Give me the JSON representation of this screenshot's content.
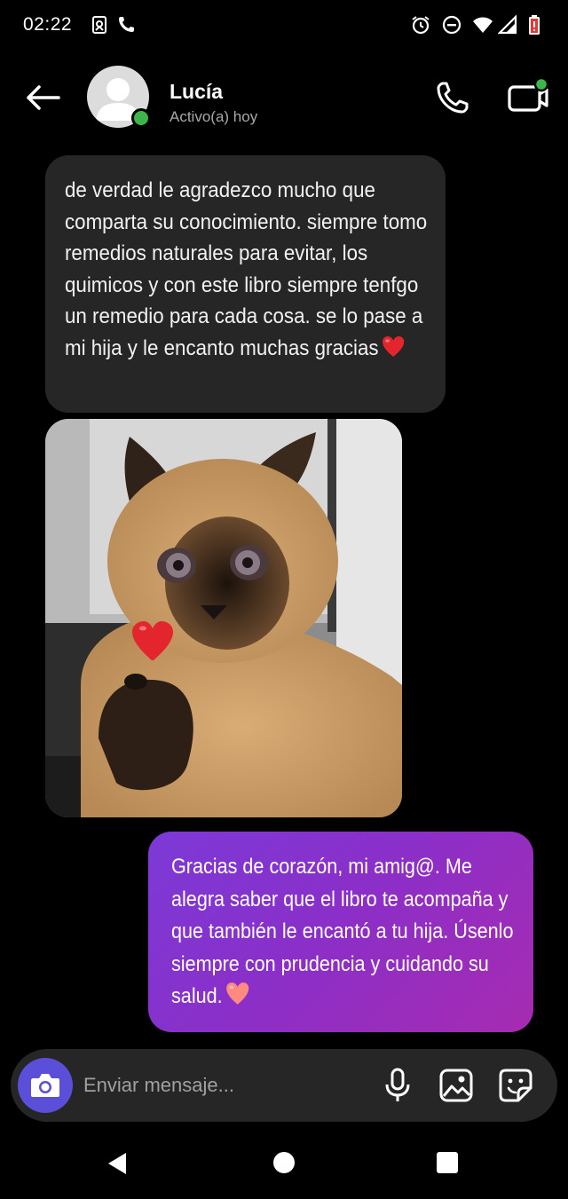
{
  "status_bar": {
    "time": "02:22",
    "left_icons": [
      "shield-screen-icon",
      "phone-call-icon"
    ],
    "right_icons": [
      "alarm-icon",
      "do-not-disturb-icon",
      "wifi-icon",
      "signal-icon",
      "battery-low-icon"
    ],
    "battery_color": "#e53935"
  },
  "header": {
    "contact_name": "Lucía",
    "contact_status": "Activo(a) hoy",
    "online_color": "#3cb54a",
    "icons": [
      "back-arrow-icon",
      "phone-icon",
      "video-camera-icon"
    ]
  },
  "messages": [
    {
      "direction": "incoming",
      "type": "text",
      "text": "de verdad le agradezco mucho que comparta su conocimiento. siempre tomo remedios naturales para evitar, los quimicos y con este libro siempre tenfgo un remedio para cada cosa. se lo pase a mi hija y le encanto muchas gracias",
      "emoji": "heart-emoji",
      "bubble_color": "#262626"
    },
    {
      "direction": "incoming",
      "type": "image",
      "image": "siamese-cat-holding-heart"
    },
    {
      "direction": "outgoing",
      "type": "text",
      "text": "Gracias de corazón, mi amig@. Me alegra saber que el libro te acompaña y que también le encantó a tu hija. Úsenlo siempre con prudencia y cuidando su salud.",
      "emoji": "heart-emoji",
      "gradient": [
        "#7c3ad6",
        "#a72bb1"
      ]
    }
  ],
  "composer": {
    "placeholder": "Enviar mensaje...",
    "camera_color": "#5b4fd9",
    "icons": [
      "camera-icon",
      "microphone-icon",
      "gallery-icon",
      "sticker-icon"
    ]
  },
  "nav_bar": {
    "icons": [
      "nav-back-icon",
      "nav-home-icon",
      "nav-recents-icon"
    ]
  }
}
